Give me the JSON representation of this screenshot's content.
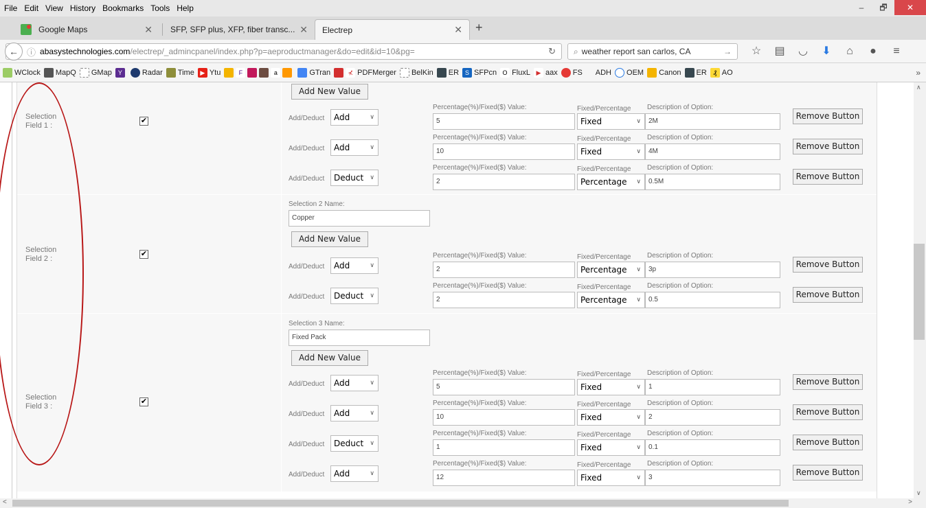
{
  "menu": [
    "File",
    "Edit",
    "View",
    "History",
    "Bookmarks",
    "Tools",
    "Help"
  ],
  "window": {
    "minimize": "–",
    "restore": "🗗",
    "close": "✕"
  },
  "tabs": [
    {
      "label": "Google Maps"
    },
    {
      "label": "SFP, SFP plus, XFP, fiber transc..."
    },
    {
      "label": "Electrep"
    }
  ],
  "new_tab": "+",
  "url": {
    "domain": "abasystechnologies.com",
    "path": "/electrep/_admincpanel/index.php?p=aeproductmanager&do=edit&id=10&pg="
  },
  "search": {
    "value": "weather report san carlos, CA"
  },
  "bookmarks": [
    "WClock",
    "MapQ",
    "GMap",
    "Radar",
    "Time",
    "Ytu",
    "GTran",
    "PDFMerger",
    "BelKin",
    "ER",
    "SFPcn",
    "FluxL",
    "aax",
    "FS",
    "ADH",
    "OEM",
    "Canon",
    "ER",
    "AO"
  ],
  "labels": {
    "add_new_value": "Add New Value",
    "add_deduct": "Add/Deduct",
    "pct_value": "Percentage(%)/Fixed($) Value:",
    "fixed_pct": "Fixed/Percentage",
    "desc": "Description of Option:",
    "remove": "Remove Button"
  },
  "fields": [
    {
      "label": "Selection\nField 1 :",
      "checked": true,
      "name_label": "",
      "name": "",
      "options": [
        {
          "op": "Add",
          "value": "5",
          "type": "Fixed",
          "desc": "2M"
        },
        {
          "op": "Add",
          "value": "10",
          "type": "Fixed",
          "desc": "4M"
        },
        {
          "op": "Deduct",
          "value": "2",
          "type": "Percentage",
          "desc": "0.5M"
        }
      ]
    },
    {
      "label": "Selection\nField 2 :",
      "checked": true,
      "name_label": "Selection 2 Name:",
      "name": "Copper",
      "options": [
        {
          "op": "Add",
          "value": "2",
          "type": "Percentage",
          "desc": "3p"
        },
        {
          "op": "Deduct",
          "value": "2",
          "type": "Percentage",
          "desc": "0.5"
        }
      ]
    },
    {
      "label": "Selection\nField 3 :",
      "checked": true,
      "name_label": "Selection 3 Name:",
      "name": "Fixed Pack",
      "options": [
        {
          "op": "Add",
          "value": "5",
          "type": "Fixed",
          "desc": "1"
        },
        {
          "op": "Add",
          "value": "10",
          "type": "Fixed",
          "desc": "2"
        },
        {
          "op": "Deduct",
          "value": "1",
          "type": "Fixed",
          "desc": "0.1"
        },
        {
          "op": "Add",
          "value": "12",
          "type": "Fixed",
          "desc": "3"
        }
      ]
    }
  ],
  "colors": {
    "annotation_oval": "#b81717",
    "close_button": "#d9474b"
  }
}
